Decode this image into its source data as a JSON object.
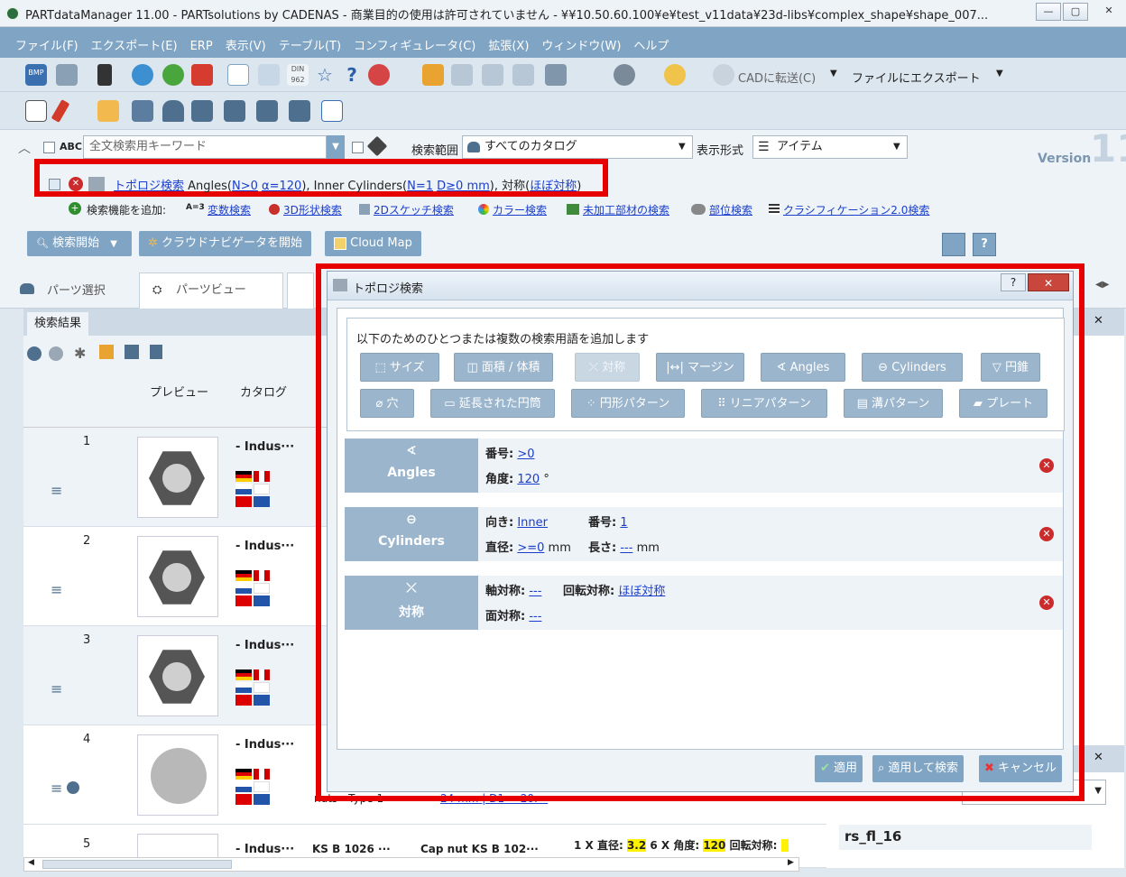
{
  "title": "PARTdataManager 11.00 - PARTsolutions by CADENAS - 商業目的の使用は許可されていません - ¥¥10.50.60.100¥e¥test_v11data¥23d-libs¥complex_shape¥shape_007...",
  "window_buttons": [
    "—",
    "▢",
    "✕"
  ],
  "menu": [
    "ファイル(F)",
    "エクスポート(E)",
    "ERP",
    "表示(V)",
    "テーブル(T)",
    "コンフィギュレータ(C)",
    "拡張(X)",
    "ウィンドウ(W)",
    "ヘルプ"
  ],
  "toolbar": {
    "bmp": "BMP",
    "din": "DIN 962",
    "cad_transfer": "CADに転送(C)",
    "file_export": "ファイルにエクスポート"
  },
  "search": {
    "abc": "ABC",
    "placeholder": "全文検索用キーワード",
    "scope_label": "検索範囲",
    "scope_value": "すべてのカタログ",
    "display_label": "表示形式",
    "display_value": "アイテム",
    "version": "Version",
    "version_num": "11"
  },
  "topology_query": {
    "link": "トポロジ検索",
    "t1": " Angles(",
    "angles_n": "N>0",
    "angles_a": "α=120",
    "t2": "), Inner Cylinders(",
    "cyl_n": "N=1",
    "cyl_d": "D≥0 mm",
    "t3": "), 対称(",
    "sym": "ほぼ対称",
    "t4": ")"
  },
  "add_functions": {
    "label": "検索機能を追加:",
    "var_prefix": "A=3",
    "items": [
      "変数検索",
      "3D形状検索",
      "2Dスケッチ検索",
      "カラー検索",
      "未加工部材の検索",
      "部位検索",
      "クラシフィケーション2.0検索"
    ]
  },
  "buttons": {
    "search_start": "検索開始",
    "cloud_navi": "クラウドナビゲータを開始",
    "cloud_map": "Cloud Map"
  },
  "tabs": [
    "パーツ選択",
    "パーツビュー"
  ],
  "results": {
    "tab": "検索結果",
    "col_preview": "プレビュー",
    "col_catalog": "カタログ",
    "rows": [
      {
        "num": "1",
        "catalog": "- Indus···"
      },
      {
        "num": "2",
        "catalog": "- Indus···"
      },
      {
        "num": "3",
        "catalog": "- Indus···"
      },
      {
        "num": "4",
        "catalog": "- Indus···",
        "extra1": "nuts - Type 1",
        "extra2": "24 mm | D1 = 20.···"
      },
      {
        "num": "5",
        "catalog": "- Indus···",
        "c2": "KS B 1026 ···",
        "c3": "Cap nut KS B 102···",
        "c4a": "1 X 直径: ",
        "c4b": "3.2",
        "c4c": " 6 X 角度: ",
        "c4d": "120",
        "c4e": " 回転対称: "
      }
    ]
  },
  "right_panel": {
    "item": "rs_fl_16"
  },
  "dialog": {
    "title": "トポロジ検索",
    "help": "?",
    "close": "✕",
    "instruction": "以下のためのひとつまたは複数の検索用語を追加します",
    "term_buttons": [
      "サイズ",
      "面積 / 体積",
      "対称",
      "マージン",
      "Angles",
      "Cylinders",
      "円錐",
      "穴",
      "延長された円筒",
      "円形パターン",
      "リニアパターン",
      "溝パターン",
      "プレート"
    ],
    "criteria": {
      "angles": {
        "name": "Angles",
        "number_label": "番号:",
        "number_value": ">0",
        "angle_label": "角度:",
        "angle_value": "120",
        "angle_unit": "°"
      },
      "cylinders": {
        "name": "Cylinders",
        "dir_label": "向き:",
        "dir_value": "Inner",
        "number_label": "番号:",
        "number_value": "1",
        "dia_label": "直径:",
        "dia_value": ">=0",
        "dia_unit": "mm",
        "len_label": "長さ:",
        "len_value": "---",
        "len_unit": "mm"
      },
      "symmetry": {
        "name": "対称",
        "axis_label": "軸対称:",
        "axis_value": "---",
        "rot_label": "回転対称:",
        "rot_value": "ほぼ対称",
        "plane_label": "面対称:",
        "plane_value": "---"
      }
    },
    "apply": "適用",
    "apply_search": "適用して検索",
    "cancel": "キャンセル"
  },
  "colors": {
    "menu": "#7fa4c4",
    "highlight": "#e60000",
    "term_button": "#9ab5cc"
  }
}
